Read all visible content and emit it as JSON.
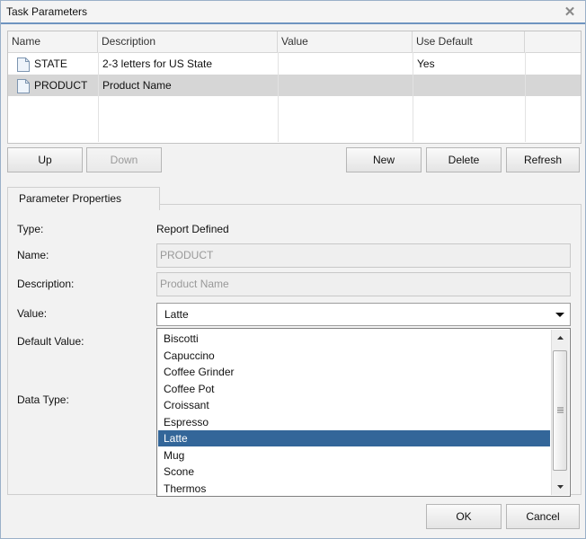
{
  "window": {
    "title": "Task Parameters",
    "close_icon": "close-icon"
  },
  "grid": {
    "columns": [
      "Name",
      "Description",
      "Value",
      "Use Default"
    ],
    "rows": [
      {
        "name": "STATE",
        "description": "2-3 letters for US State",
        "value": "",
        "use_default": "Yes",
        "icon": "document-icon"
      },
      {
        "name": "PRODUCT",
        "description": "Product Name",
        "value": "",
        "use_default": "",
        "icon": "document-icon"
      }
    ],
    "selected_row": 1
  },
  "buttons": {
    "up": "Up",
    "down": "Down",
    "new": "New",
    "delete": "Delete",
    "refresh": "Refresh"
  },
  "properties": {
    "title": "Parameter Properties",
    "type_label": "Type:",
    "type_value": "Report Defined",
    "name_label": "Name:",
    "name_value": "PRODUCT",
    "description_label": "Description:",
    "description_value": "Product Name",
    "value_label": "Value:",
    "value_selected": "Latte",
    "default_value_label": "Default Value:",
    "data_type_label": "Data Type:"
  },
  "dropdown": {
    "options": [
      "Biscotti",
      "Capuccino",
      "Coffee Grinder",
      "Coffee Pot",
      "Croissant",
      "Espresso",
      "Latte",
      "Mug",
      "Scone",
      "Thermos"
    ],
    "selected": "Latte"
  },
  "footer": {
    "ok": "OK",
    "cancel": "Cancel"
  },
  "colors": {
    "accent": "#336699",
    "title_border": "#6e94c0"
  }
}
